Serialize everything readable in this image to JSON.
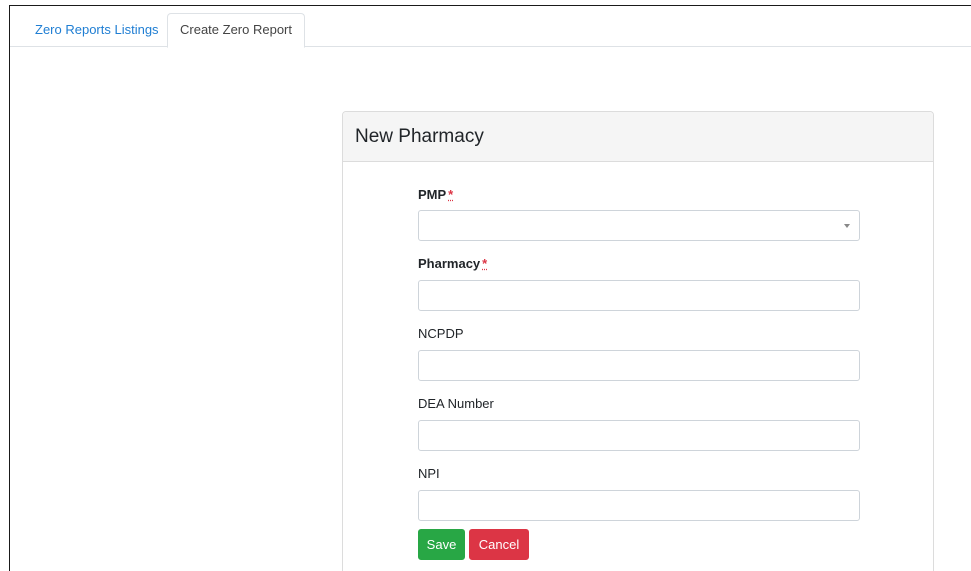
{
  "tabs": [
    {
      "label": "Zero Reports Listings",
      "active": false
    },
    {
      "label": "Create Zero Report",
      "active": true
    }
  ],
  "card": {
    "title": "New Pharmacy"
  },
  "form": {
    "required_marker": "*",
    "pmp": {
      "label": "PMP",
      "value": "",
      "required": true
    },
    "pharmacy": {
      "label": "Pharmacy",
      "value": "",
      "required": true
    },
    "ncpdp": {
      "label": "NCPDP",
      "value": "",
      "required": false
    },
    "dea_number": {
      "label": "DEA Number",
      "value": "",
      "required": false
    },
    "npi": {
      "label": "NPI",
      "value": "",
      "required": false
    }
  },
  "actions": {
    "save_label": "Save",
    "cancel_label": "Cancel"
  },
  "colors": {
    "link": "#1f7ed3",
    "save": "#28a745",
    "cancel": "#dc3545",
    "required": "#dc3545",
    "card_header_bg": "#f5f5f5"
  },
  "icons": {
    "select_caret": "chevron-down-icon"
  }
}
